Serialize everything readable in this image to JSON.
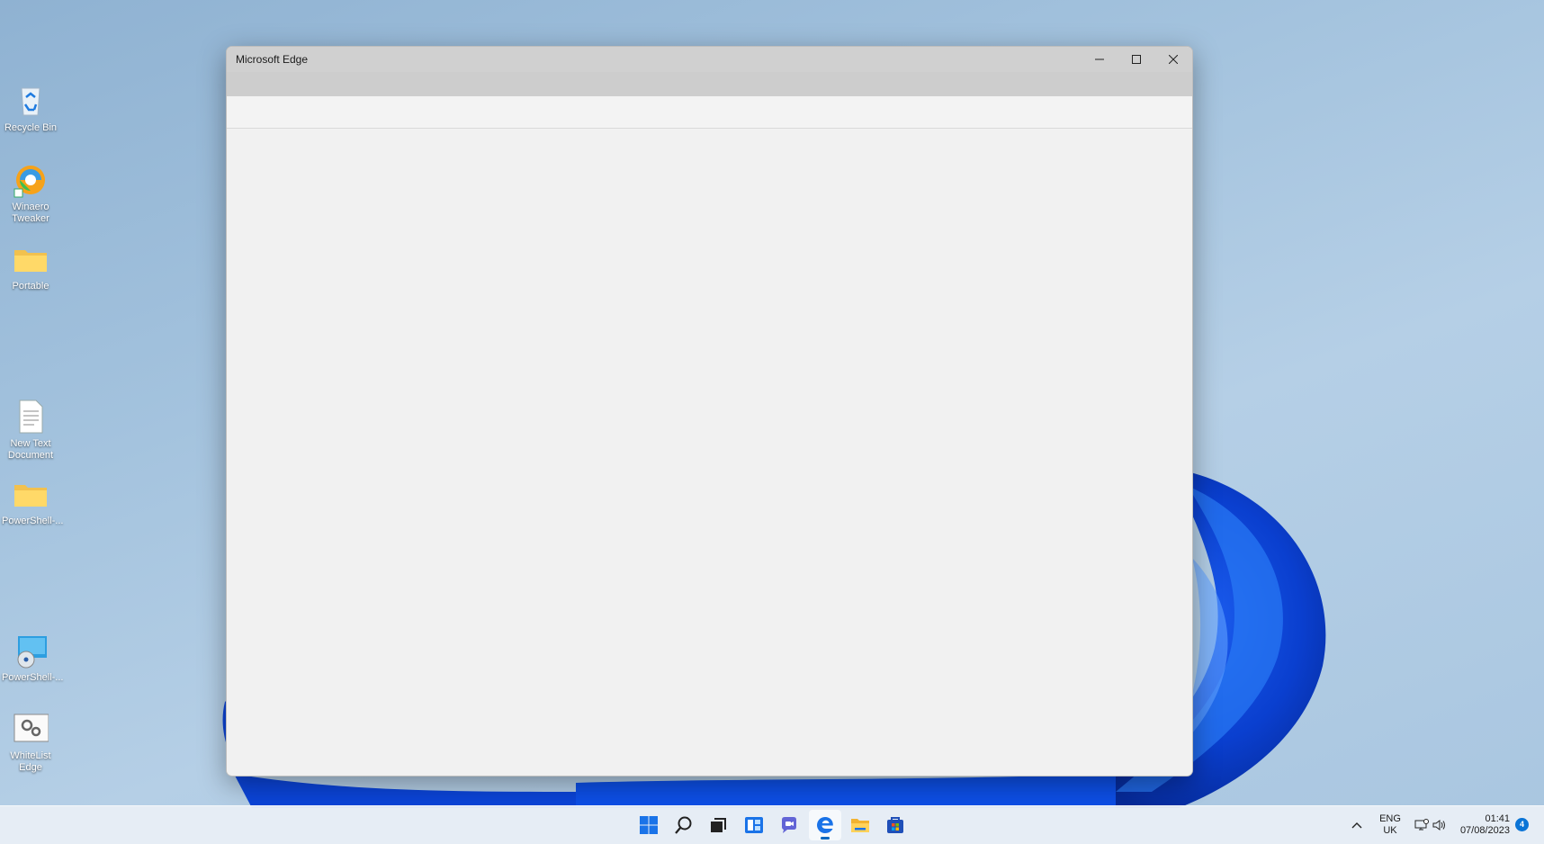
{
  "desktop": {
    "icons": [
      {
        "label": "Recycle Bin",
        "icon": "recycle-bin-icon"
      },
      {
        "label": "Winaero Tweaker",
        "icon": "winaero-tweaker-icon"
      },
      {
        "label": "Portable",
        "icon": "folder-icon"
      },
      {
        "label": "New Text Document",
        "icon": "text-document-icon"
      },
      {
        "label": "PowerShell-...",
        "icon": "folder-icon"
      },
      {
        "label": "PowerShell-...",
        "icon": "disc-image-icon"
      },
      {
        "label": "WhiteList Edge",
        "icon": "settings-shortcut-icon"
      }
    ]
  },
  "window": {
    "title": "Microsoft Edge",
    "controls": [
      "minimize-icon",
      "maximize-icon",
      "close-icon"
    ]
  },
  "taskbar": {
    "apps": [
      "start-icon",
      "search-icon",
      "task-view-icon",
      "widgets-icon",
      "teams-chat-icon",
      "edge-icon",
      "file-explorer-icon",
      "store-icon"
    ],
    "active_app": "edge-icon",
    "tray": {
      "language": "ENG",
      "region": "UK",
      "time": "01:41",
      "date": "07/08/2023",
      "notifications": "4"
    }
  },
  "colors": {
    "accent": "#0067c0",
    "window_bg": "#f1f1f1",
    "titlebar_bg": "#d0d0d0"
  }
}
